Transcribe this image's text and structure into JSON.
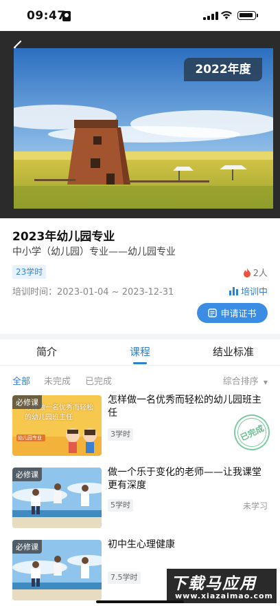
{
  "status_bar": {
    "time": "09:47"
  },
  "hero": {
    "year_badge": "2022年度"
  },
  "course": {
    "title": "2023年幼儿园专业",
    "subtitle": "中小学（幼儿园）专业——幼儿园专业",
    "hours": "23学时",
    "people": "2人",
    "train_time": "培训时间：2023-01-04 ~ 2023-12-31",
    "status": "培训中",
    "apply_label": "申请证书"
  },
  "tabs": [
    {
      "label": "简介",
      "active": false
    },
    {
      "label": "课程",
      "active": true
    },
    {
      "label": "结业标准",
      "active": false
    }
  ],
  "filters": [
    {
      "label": "全部",
      "active": true
    },
    {
      "label": "未完成",
      "active": false
    },
    {
      "label": "已完成",
      "active": false
    }
  ],
  "sort_label": "综合排序",
  "courses": [
    {
      "tag": "必修课",
      "title": "怎样做一名优秀而轻松的幼儿园班主任",
      "hours": "3学时",
      "status": "",
      "stamp": "已完成",
      "thumb_text": "怎样做一名优秀而轻松的幼儿园班主任",
      "thumb_badge": "幼儿园专业"
    },
    {
      "tag": "必修课",
      "title": "做一个乐于变化的老师——让我课堂更有深度",
      "hours": "5学时",
      "status": "未学习"
    },
    {
      "tag": "必修课",
      "title": "初中生心理健康",
      "hours": "7.5学时",
      "status": ""
    }
  ],
  "watermark": {
    "big": "下载马应用",
    "small": "www.xiazaimao.com"
  },
  "colors": {
    "accent": "#2f7fd1",
    "button": "#3b8ce3",
    "stamp": "#7ccba0",
    "hero_bg": "#2b2b2b"
  }
}
